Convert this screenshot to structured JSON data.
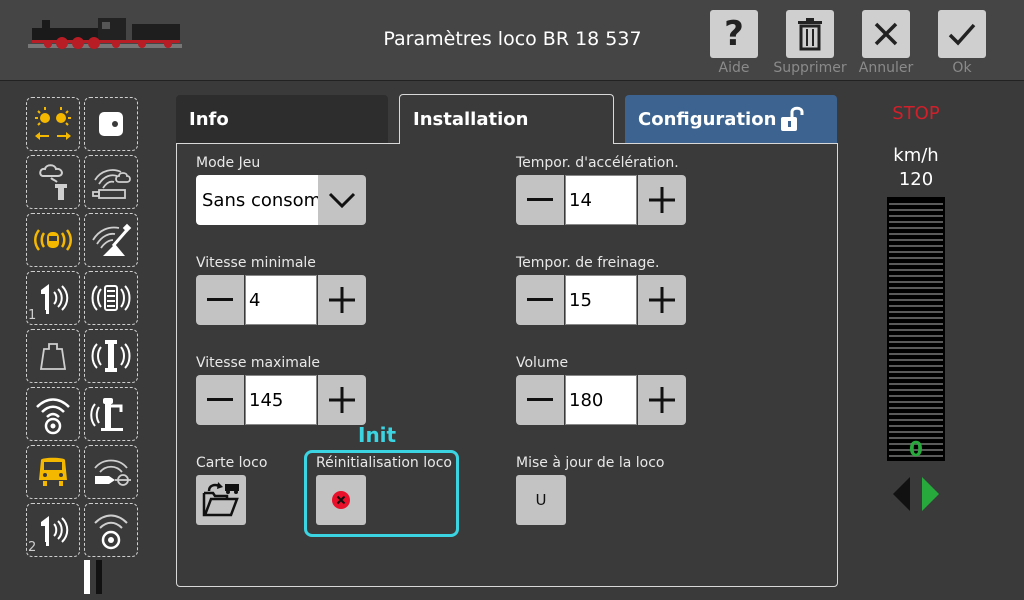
{
  "header": {
    "title": "Paramètres loco BR 18 537",
    "buttons": [
      {
        "icon": "help-icon",
        "label": "Aide"
      },
      {
        "icon": "trash-icon",
        "label": "Supprimer"
      },
      {
        "icon": "close-icon",
        "label": "Annuler"
      },
      {
        "icon": "check-icon",
        "label": "Ok"
      }
    ]
  },
  "sidebar": {
    "functions": [
      {
        "icon": "headlights-icon",
        "active": true
      },
      {
        "icon": "smoke-generator-icon",
        "active": false
      },
      {
        "icon": "bell-sound-icon",
        "active": true
      },
      {
        "icon": "horn-sound-icon",
        "active": false,
        "number": "1"
      },
      {
        "icon": "weight-icon",
        "active": false
      },
      {
        "icon": "radio-wheel-icon",
        "active": false
      },
      {
        "icon": "locomotive-front-icon",
        "active": true
      },
      {
        "icon": "horn-sound-icon",
        "active": false,
        "number": "2"
      },
      {
        "icon": "cab-light-icon",
        "active": false
      },
      {
        "icon": "coal-sound-icon",
        "active": false
      },
      {
        "icon": "shovel-sound-icon",
        "active": false
      },
      {
        "icon": "air-pump-sound-icon",
        "active": false
      },
      {
        "icon": "injector-sound-icon",
        "active": false
      },
      {
        "icon": "water-pump-sound-icon",
        "active": false
      },
      {
        "icon": "coupling-sound-icon",
        "active": false
      },
      {
        "icon": "wheel-sound-icon",
        "active": false
      }
    ]
  },
  "tabs": {
    "info": "Info",
    "installation": "Installation",
    "configuration": "Configuration",
    "active": "installation"
  },
  "fields": {
    "mode_jeu": {
      "label": "Mode Jeu",
      "value": "Sans consommation"
    },
    "vitesse_min": {
      "label": "Vitesse minimale",
      "value": "4"
    },
    "vitesse_max": {
      "label": "Vitesse maximale",
      "value": "145"
    },
    "accel": {
      "label": "Tempor. d'accélération.",
      "value": "14"
    },
    "frein": {
      "label": "Tempor. de freinage.",
      "value": "15"
    },
    "volume": {
      "label": "Volume",
      "value": "180"
    },
    "carte_loco": {
      "label": "Carte loco"
    },
    "reinit": {
      "label": "Réinitialisation loco"
    },
    "maj": {
      "label": "Mise à jour de la loco",
      "button": "U"
    }
  },
  "annotation": {
    "label": "Init",
    "color": "#3ad4e2"
  },
  "speed": {
    "stop": "STOP",
    "unit": "km/h",
    "max": "120",
    "current": "0",
    "fraction": 0
  },
  "colors": {
    "accent_yellow": "#f5b800",
    "config_tab": "#3d6490",
    "stop_red": "#d21f2a",
    "speed_green": "#27a93c"
  }
}
